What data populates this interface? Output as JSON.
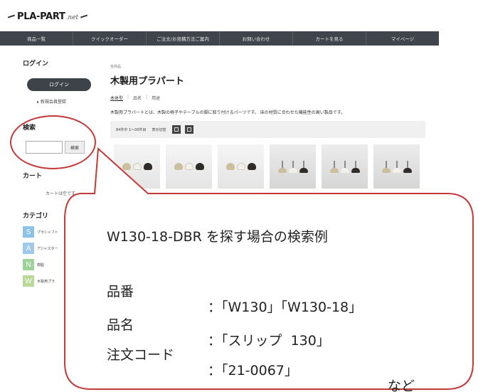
{
  "logo": {
    "brand": "PLA-PART",
    "tld": ".net"
  },
  "nav": {
    "items": [
      "商品一覧",
      "クイックオーダー",
      "ご注文/お見積方法ご案内",
      "お問い合わせ",
      "カートを見る",
      "マイページ"
    ]
  },
  "sidebar": {
    "login_heading": "ログイン",
    "login_button": "ログイン",
    "register_link": "▸ 新規会員登録",
    "search_heading": "検索",
    "search_value": "",
    "search_button": "検索",
    "cart_heading": "カート",
    "cart_empty": "カートは空です",
    "category_heading": "カテゴリ",
    "categories": [
      {
        "letter": "S",
        "label": "プラシャフト",
        "color": "#8cc2ea"
      },
      {
        "letter": "A",
        "label": "アジャスター",
        "color": "#9fc9ec"
      },
      {
        "letter": "N",
        "label": "樹脂",
        "color": "#9ed49b"
      },
      {
        "letter": "W",
        "label": "木製用プラ",
        "color": "#b8d99a"
      }
    ]
  },
  "main": {
    "breadcrumb": "全商品",
    "title": "木製用プラパート",
    "tabs": [
      "本体型",
      "品名",
      "用途"
    ],
    "description": "木製用プラパートとは、木製の椅子やテーブルの脚に取り付けるパーツです。 床の材質に合わせた機能性の高い製品です。",
    "result_count": "84件中 1～30件目",
    "display_label": "表示切替"
  },
  "callout": {
    "title": "W130-18-DBR を探す場合の検索例",
    "rows": [
      {
        "label": "品番",
        "value": "：「W130」「W130-18」"
      },
      {
        "label": "品名",
        "value": "：「スリップ  130」"
      },
      {
        "label": "注文コード",
        "value": "：「21-0067」"
      }
    ],
    "etc": "など"
  },
  "colors": {
    "nav_bg": "#3f454b",
    "callout_border": "#c43a3a",
    "button_dark": "#3d4348"
  }
}
